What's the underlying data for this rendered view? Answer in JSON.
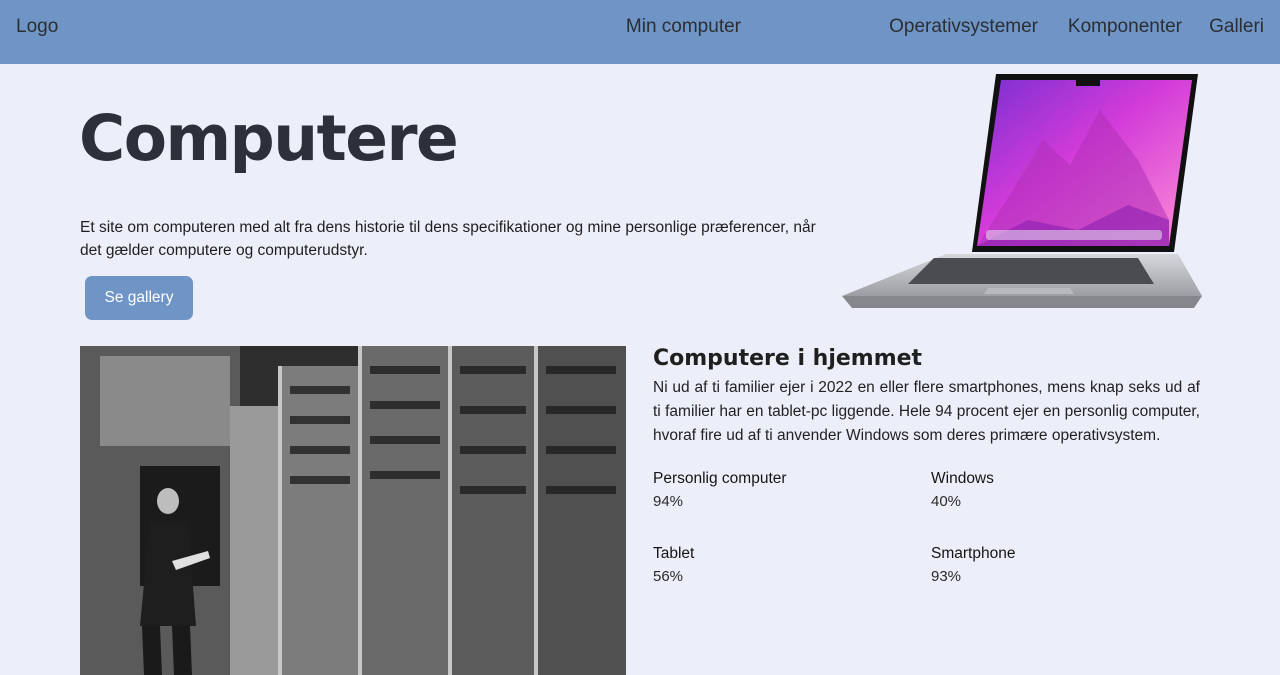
{
  "header": {
    "logo": "Logo",
    "nav": [
      {
        "label": "Min computer"
      },
      {
        "label": "Operativsystemer"
      },
      {
        "label": "Komponenter"
      },
      {
        "label": "Galleri"
      }
    ]
  },
  "hero": {
    "title": "Computere",
    "text": "Et site om computeren med alt fra dens historie til dens specifikationer og mine personlige præferencer, når det gælder computere og computerudstyr.",
    "button": "Se gallery"
  },
  "section": {
    "title": "Computere i hjemmet",
    "text": "Ni ud af ti familier ejer i 2022 en eller flere smartphones, mens knap seks ud af ti familier har en tablet-pc liggende. Hele 94 procent ejer en personlig computer, hvoraf fire ud af ti anvender Windows som deres primære operativsystem.",
    "stats": [
      {
        "label": "Personlig computer",
        "value": "94%"
      },
      {
        "label": "Windows",
        "value": "40%"
      },
      {
        "label": "Tablet",
        "value": "56%"
      },
      {
        "label": "Smartphone",
        "value": "93%"
      }
    ]
  },
  "colors": {
    "header_bg": "#6f95c6",
    "page_bg": "#eceff9",
    "button_bg": "#6f95c6",
    "button_text": "#ffffff"
  }
}
